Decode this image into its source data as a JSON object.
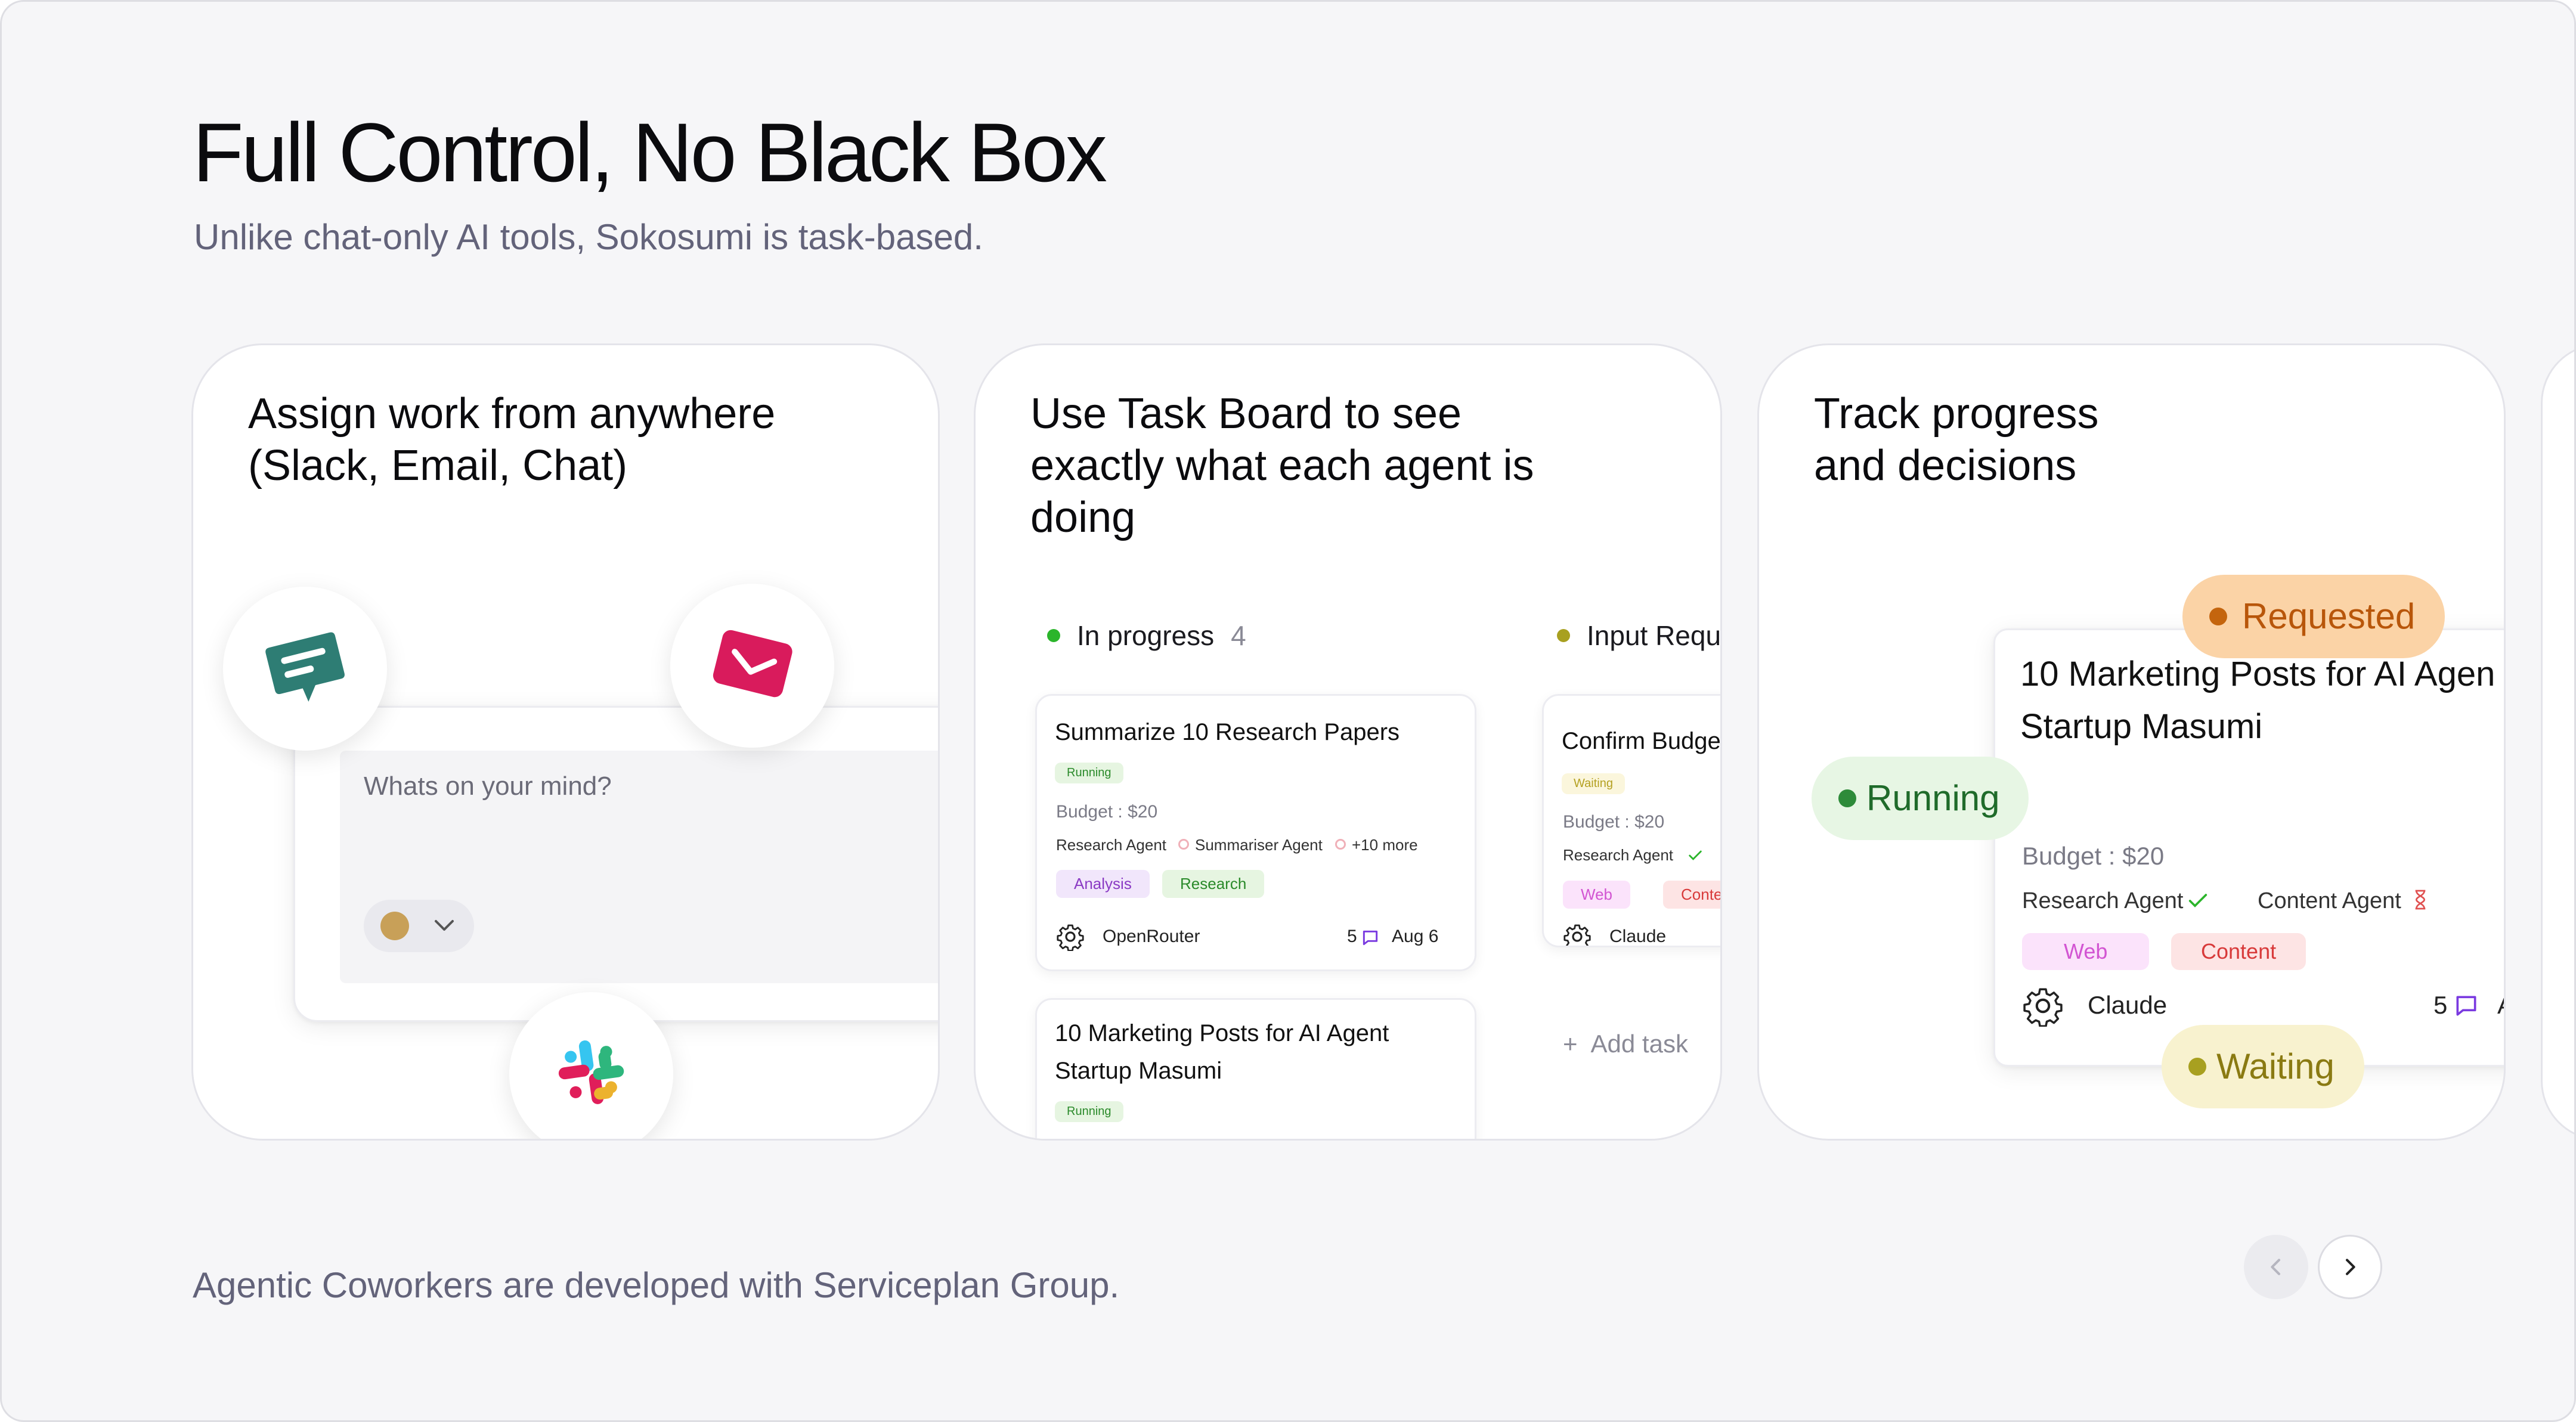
{
  "header": {
    "title": "Full Control, No Black Box",
    "subtitle": "Unlike chat-only AI tools, Sokosumi is task-based."
  },
  "footer": "Agentic Coworkers are developed with Serviceplan Group.",
  "cards": [
    {
      "title": "Assign work from anywhere (Slack, Email, Chat)",
      "input_placeholder": "Whats on your mind?",
      "icons": [
        "chat-icon",
        "email-icon",
        "slack-icon"
      ]
    },
    {
      "title": "Use Task Board to see exactly what each agent is doing",
      "columns": [
        {
          "name": "In progress",
          "count": "4",
          "color": "#2bb52b"
        },
        {
          "name": "Input Requ",
          "count": "",
          "color": "#a8a020"
        }
      ],
      "tasks": [
        {
          "title": "Summarize 10 Research Papers",
          "status": "Running",
          "budget": "Budget : $20",
          "agents": [
            "Research Agent",
            "Summariser Agent",
            "+10 more"
          ],
          "tags": [
            "Analysis",
            "Research"
          ],
          "model": "OpenRouter",
          "comments": "5",
          "date": "Aug 6"
        },
        {
          "title_line1": "10 Marketing Posts for AI Agent",
          "title_line2": "Startup Masumi",
          "status": "Running"
        },
        {
          "title": "Confirm Budge",
          "status": "Waiting",
          "budget": "Budget : $20",
          "agents": [
            "Research Agent"
          ],
          "tags": [
            "Web",
            "Conte"
          ],
          "model": "Claude"
        }
      ],
      "add_task": "Add task"
    },
    {
      "title": "Track progress and decisions",
      "task": {
        "title_line1": "10 Marketing Posts for AI Agen",
        "title_line2": "Startup Masumi",
        "budget": "Budget : $20",
        "agents": [
          "Research Agent",
          "Content Agent"
        ],
        "tags": [
          "Web",
          "Content"
        ],
        "model": "Claude",
        "comments": "5",
        "date_partial": "A"
      },
      "pills": {
        "requested": "Requested",
        "running": "Running",
        "waiting": "Waiting"
      }
    }
  ],
  "nav": {
    "prev": "previous",
    "next": "next"
  },
  "colors": {
    "running_bg": "#e7f6e4",
    "running_text": "#1f6b2a",
    "requested_bg": "#fbd3a6",
    "requested_text": "#b8560a",
    "waiting_bg": "#f8f2cf",
    "waiting_text": "#8a7a12",
    "chat_icon": "#2e7d74",
    "email_icon": "#d91b5c"
  }
}
